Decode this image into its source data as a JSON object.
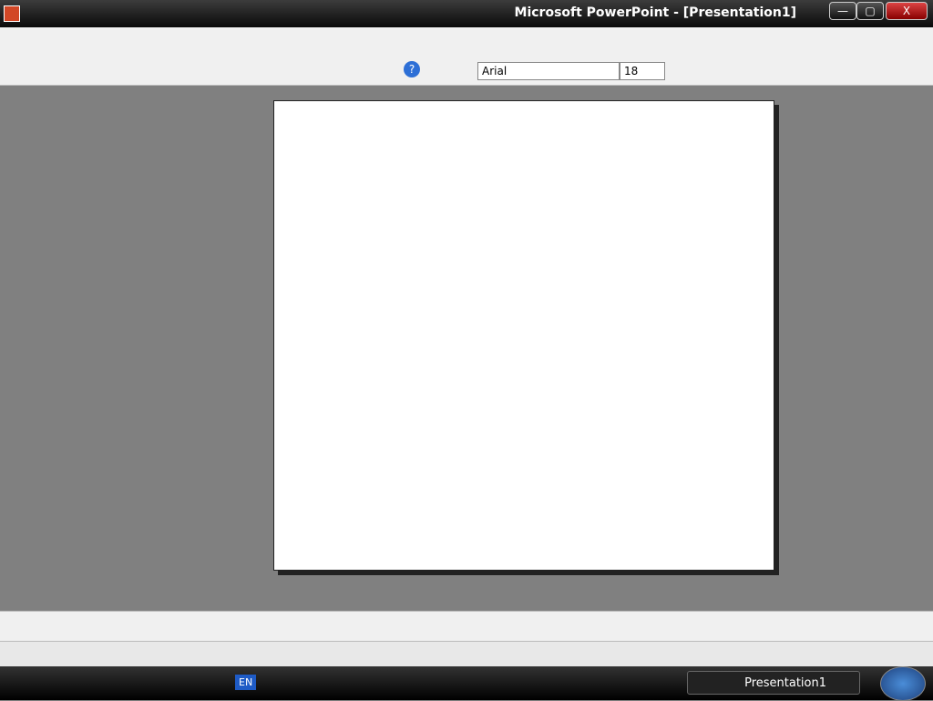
{
  "window": {
    "title": "Microsoft PowerPoint - [Presentation1]",
    "minimize": "—",
    "maximize": "▢",
    "close": "X"
  },
  "toolbar": {
    "font": "Arial",
    "font_size": "18",
    "help": "?"
  },
  "taskbar": {
    "task": "Presentation1",
    "lang": "EN"
  }
}
